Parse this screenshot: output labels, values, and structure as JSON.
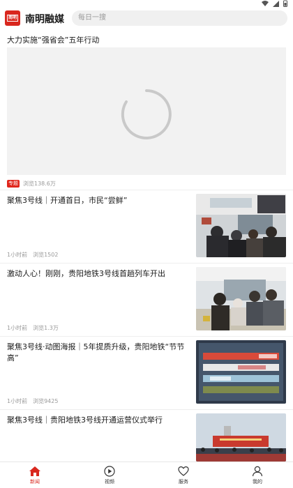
{
  "header": {
    "app_title": "南明融媒",
    "logo_text": "南明",
    "search_placeholder": "每日一搜"
  },
  "featured": {
    "title": "大力实施“强省会”五年行动",
    "tag": "专题",
    "views": "浏览138.6万"
  },
  "news": [
    {
      "title": "聚焦3号线｜开通首日，市民“尝鲜”",
      "time": "1小时前",
      "views": "浏览1502"
    },
    {
      "title": "激动人心！刚刚，贵阳地铁3号线首趟列车开出",
      "time": "1小时前",
      "views": "浏览1.3万"
    },
    {
      "title": "聚焦3号线·动图海报｜5年提质升级，贵阳地铁“节节高”",
      "time": "1小时前",
      "views": "浏览9425"
    },
    {
      "title": "聚焦3号线｜贵阳地铁3号线开通运营仪式举行",
      "time": "",
      "views": ""
    }
  ],
  "tabs": [
    {
      "label": "新闻",
      "icon": "home-icon",
      "active": true
    },
    {
      "label": "视频",
      "icon": "play-icon",
      "active": false
    },
    {
      "label": "服务",
      "icon": "heart-icon",
      "active": false
    },
    {
      "label": "我的",
      "icon": "user-icon",
      "active": false
    }
  ],
  "colors": {
    "accent": "#d9271e",
    "muted_text": "#999999"
  }
}
